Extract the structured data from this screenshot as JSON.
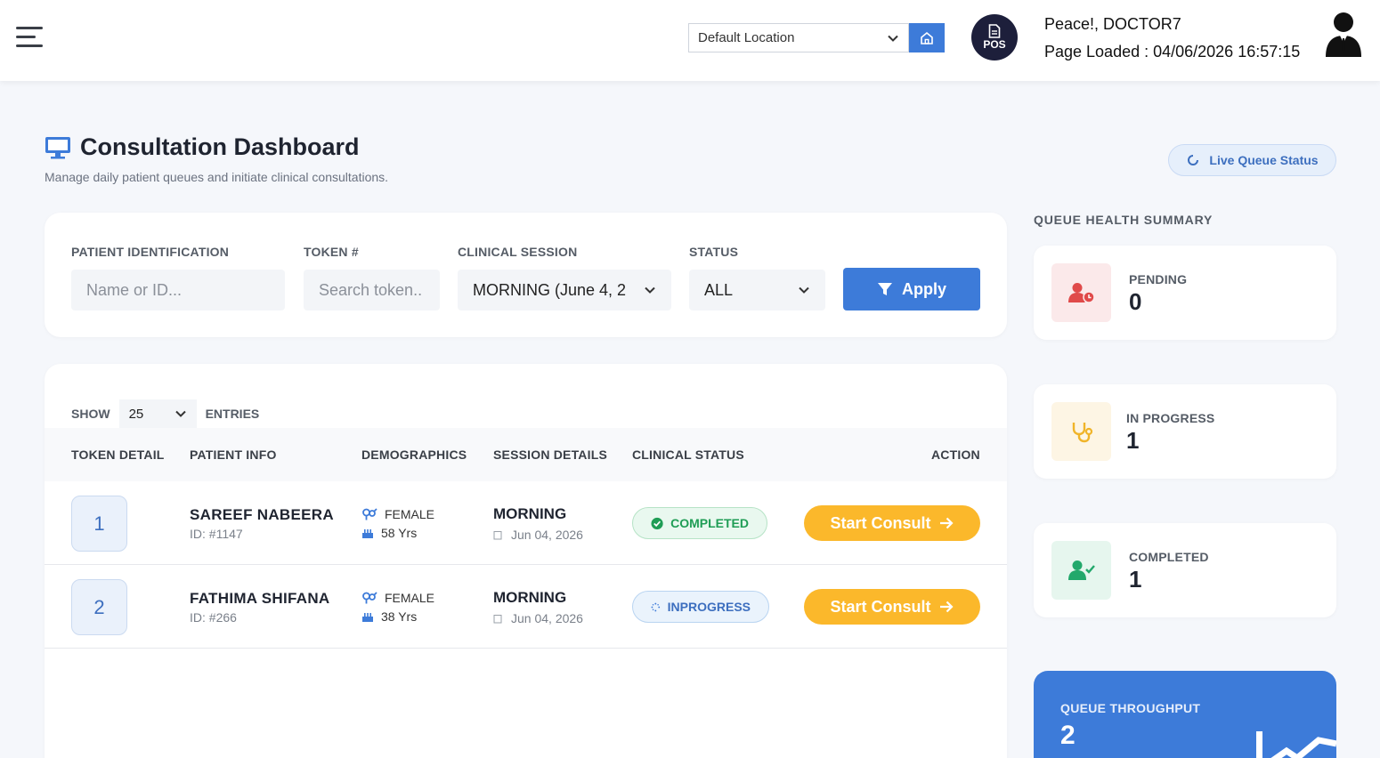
{
  "header": {
    "location": "Default Location",
    "pos_label": "POS",
    "greeting": "Peace!, DOCTOR7",
    "page_loaded": "Page Loaded : 04/06/2026 16:57:15"
  },
  "page": {
    "title": "Consultation Dashboard",
    "subtitle": "Manage daily patient queues and initiate clinical consultations.",
    "live_button": "Live Queue Status"
  },
  "filters": {
    "patient_label": "PATIENT IDENTIFICATION",
    "patient_placeholder": "Name or ID...",
    "token_label": "TOKEN #",
    "token_placeholder": "Search token..",
    "session_label": "CLINICAL SESSION",
    "session_value": "MORNING (June 4, 2",
    "status_label": "STATUS",
    "status_value": "ALL",
    "apply_label": "Apply"
  },
  "table": {
    "show_label": "SHOW",
    "entries_value": "25",
    "entries_label": "ENTRIES",
    "columns": [
      "TOKEN DETAIL",
      "PATIENT INFO",
      "DEMOGRAPHICS",
      "SESSION DETAILS",
      "CLINICAL STATUS",
      "ACTION"
    ],
    "rows": [
      {
        "token": "1",
        "name": "SAREEF NABEERA",
        "id": "ID: #1147",
        "gender": "FEMALE",
        "age": "58 Yrs",
        "session": "MORNING",
        "date": "Jun 04, 2026",
        "status": "COMPLETED",
        "action": "Start Consult"
      },
      {
        "token": "2",
        "name": "FATHIMA SHIFANA",
        "id": "ID: #266",
        "gender": "FEMALE",
        "age": "38 Yrs",
        "session": "MORNING",
        "date": "Jun 04, 2026",
        "status": "INPROGRESS",
        "action": "Start Consult"
      }
    ]
  },
  "summary": {
    "title": "QUEUE HEALTH SUMMARY",
    "pending": {
      "label": "PENDING",
      "value": "0",
      "color": "#e04a4a"
    },
    "in_progress": {
      "label": "IN PROGRESS",
      "value": "1",
      "color": "#f0b429"
    },
    "completed": {
      "label": "COMPLETED",
      "value": "1",
      "color": "#22a86b"
    },
    "throughput": {
      "label": "QUEUE THROUGHPUT",
      "value": "2"
    }
  },
  "colors": {
    "primary": "#3d7bd9",
    "accent": "#fbb82b",
    "success": "#1f9d55"
  }
}
